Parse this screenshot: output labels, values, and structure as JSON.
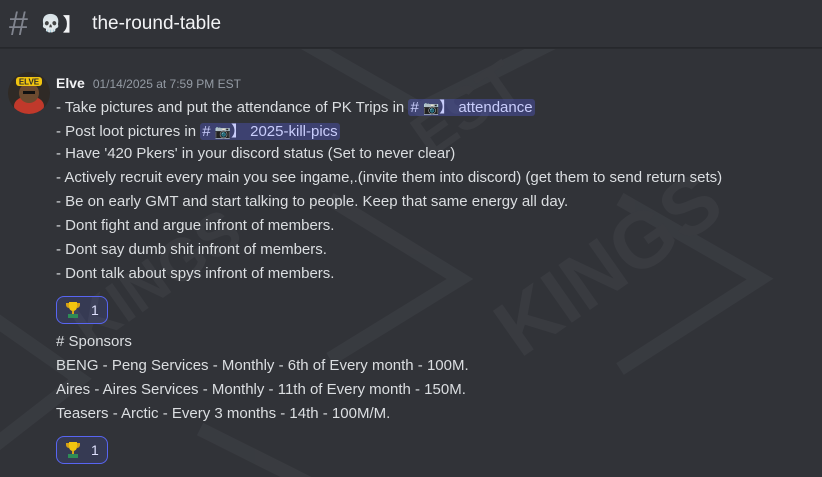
{
  "channel": {
    "hash": "#",
    "emoji": "💀",
    "bracket": "】",
    "name": "the-round-table"
  },
  "message": {
    "author": "Elve",
    "timestamp": "01/14/2025 at 7:59 PM EST",
    "avatar_text": "ELVE",
    "lines": [
      {
        "pre": "- Take pictures and put the attendance of PK Trips in ",
        "mention": {
          "hash": "#",
          "emoji": "📷",
          "bracket": "】",
          "name": "attendance"
        }
      },
      {
        "pre": "- Post loot pictures in ",
        "mention": {
          "hash": "#",
          "emoji": "📷",
          "bracket": "】",
          "name": "2025-kill-pics"
        }
      },
      {
        "text": "- Have '420 Pkers' in your discord status (Set to never clear)"
      },
      {
        "text": "- Actively recruit every main you see ingame,.(invite them into discord) (get them to send return sets)"
      },
      {
        "text": "- Be on early GMT and start talking to people. Keep that same energy all day."
      },
      {
        "text": "- Dont fight and argue infront of members."
      },
      {
        "text": "- Dont say dumb shit infront of members."
      },
      {
        "text": "- Dont talk about spys infront of members."
      }
    ],
    "reaction1": {
      "emoji": "trophy",
      "count": "1"
    },
    "sponsors_heading": "# Sponsors",
    "sponsors": [
      "BENG - Peng Services - Monthly - 6th of Every month - 100M.",
      "Aires - Aires Services - Monthly - 11th of Every month - 150M.",
      "Teasers - Arctic - Every 3 months - 14th - 100M/M."
    ],
    "reaction2": {
      "emoji": "trophy",
      "count": "1"
    }
  },
  "colors": {
    "background": "#313338",
    "mention_bg": "#3c4270",
    "reaction_border": "#5865f2"
  }
}
